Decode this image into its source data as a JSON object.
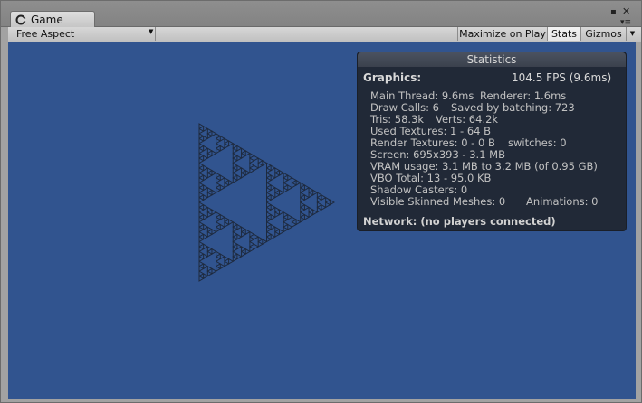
{
  "window": {
    "tab_label": "Game",
    "menu_icon": "menu-lines-icon",
    "close_icon": "close-icon"
  },
  "toolbar": {
    "aspect": "Free Aspect",
    "maximize": "Maximize on Play",
    "stats": "Stats",
    "gizmos": "Gizmos"
  },
  "stats": {
    "title": "Statistics",
    "graphics_label": "Graphics:",
    "fps": "104.5 FPS (9.6ms)",
    "main_thread": "Main Thread: 9.6ms",
    "renderer": "Renderer: 1.6ms",
    "draw_calls": "Draw Calls: 6",
    "saved_by_batching": "Saved by batching: 723",
    "tris": "Tris: 58.3k",
    "verts": "Verts: 64.2k",
    "used_textures": "Used Textures: 1 - 64 B",
    "render_textures": "Render Textures: 0 - 0 B",
    "switches": "switches: 0",
    "screen": "Screen: 695x393 - 3.1 MB",
    "vram": "VRAM usage: 3.1 MB to 3.2 MB (of 0.95 GB)",
    "vbo": "VBO Total: 13 - 95.0 KB",
    "shadow_casters": "Shadow Casters: 0",
    "skinned_meshes": "Visible Skinned Meshes: 0",
    "animations": "Animations: 0",
    "network": "Network: (no players connected)"
  },
  "colors": {
    "viewport_bg": "#31548f",
    "fractal_stroke": "#1e2a3e"
  }
}
